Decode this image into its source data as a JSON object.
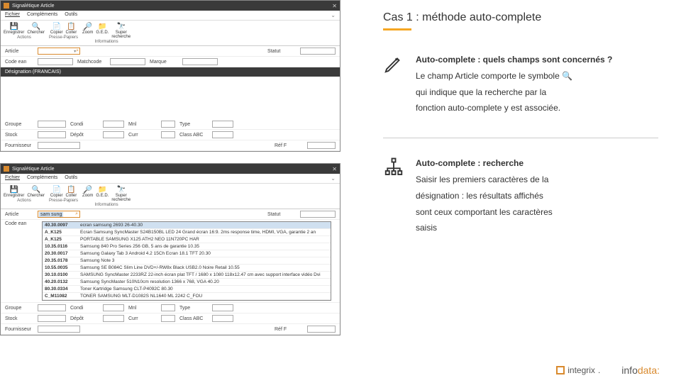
{
  "case_title": "Cas 1 : méthode auto-complete",
  "block1": {
    "title": "Auto-complete : quels champs sont concernés ?",
    "text_a": "Le champ Article comporte le symbole",
    "text_b": "qui indique que la recherche par la",
    "text_c": "fonction auto-complete y est associée."
  },
  "block2": {
    "title": "Auto-complete : recherche",
    "text_a": "Saisir les premiers caractères de la",
    "text_b": "désignation : les résultats affichés",
    "text_c": "sont ceux comportant les caractères",
    "text_d": "saisis"
  },
  "app": {
    "title": "Signalétique Article",
    "menu": {
      "fichier": "Fichier",
      "complements": "Compléments",
      "outils": "Outils"
    },
    "ribbon": {
      "enregistrer": "Enregistrer",
      "chercher": "Chercher",
      "copier": "Copier",
      "coller": "Coller",
      "zoom": "Zoom",
      "ged": "G.E.D.",
      "super": "Super",
      "recherche": "recherche",
      "g_actions": "Actions",
      "g_presse": "Presse-Papiers",
      "g_info": "Informations"
    },
    "labels": {
      "article": "Article",
      "statut": "Statut",
      "codeean": "Code ean",
      "matchcode": "Matchcode",
      "marque": "Marque",
      "designation": "Désignation (FRANCAIS)",
      "groupe": "Groupe",
      "condi": "Condi",
      "mni": "Mnl",
      "type": "Type",
      "stock": "Stock",
      "depot": "Dépôt",
      "curr": "Curr",
      "class": "Class ABC",
      "fournisseur": "Fournisseur",
      "ref": "Réf F"
    }
  },
  "search_value": "sam sung",
  "dropdown": [
    {
      "code": "40.30.0097",
      "desc": "ecran samsung 2693 26-40.30"
    },
    {
      "code": "A_K125",
      "desc": "Ecran Samsung SyncMaster S24B150BL LED 24     Grand écran 16:9. 2ms response time, HDMI, VGA, garantie 2 an"
    },
    {
      "code": "A_K125",
      "desc": "PORTABLE SAMSUNG X125 ATH2 NEO 11N720PC HAR"
    },
    {
      "code": "10.35.0116",
      "desc": "Samsung 840 Pro Series 256 GB, 5 ans de garantie 10.35"
    },
    {
      "code": "20.30.0017",
      "desc": "Samsung Galaxy Tab 3 Android 4.2 15Ch Ecran 18.1 TFT 20.30"
    },
    {
      "code": "20.35.0178",
      "desc": "Samsung Note 3"
    },
    {
      "code": "10.55.0035",
      "desc": "Samsung SE B084C Slim Line DVD+/-RW8x Black USB2.0 Noire Retail 10.55"
    },
    {
      "code": "30.10.0100",
      "desc": "SAMSUNG SyncMaster 2233RZ 22-inch écran plat TFT / 1680 x 1080 118x12.47 cm avec support interface vidéo Dvi"
    },
    {
      "code": "40.20.0132",
      "desc": "Samsung SyncMaster 510N10cm resolution 1366 x 768, VGA 40.20"
    },
    {
      "code": "80.30.0334",
      "desc": "Toner Kartridge Samsung CLT-P4092C 80.30"
    },
    {
      "code": "C_M11082",
      "desc": "TONER SAMSUNG MLT-D1082S NL1640 ML 2242 C_FOU"
    }
  ],
  "logos": {
    "integrix": "integrix",
    "infodata_a": "info",
    "infodata_b": "data"
  }
}
